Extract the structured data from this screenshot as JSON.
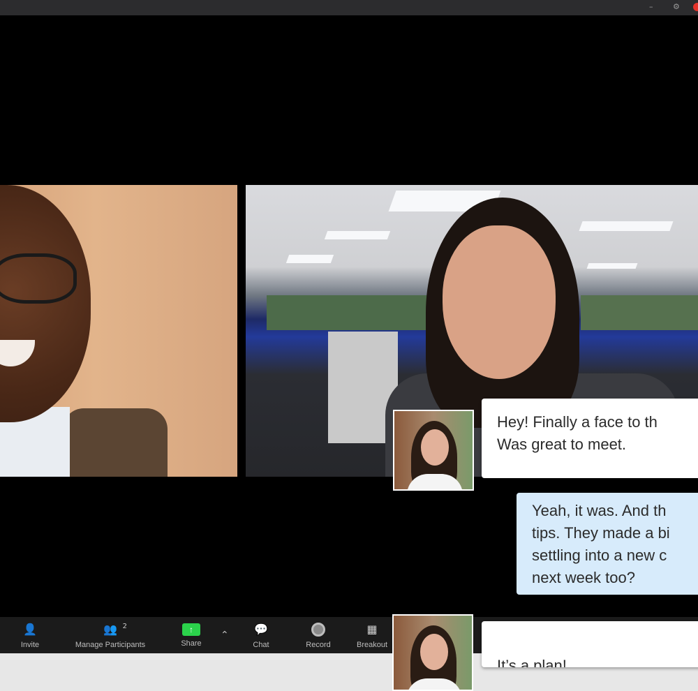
{
  "window": {
    "minimize_glyph": "–",
    "maximize_glyph": "⚙"
  },
  "chat": {
    "messages": [
      {
        "direction": "incoming",
        "text": "Hey! Finally a face to th\nWas great to meet."
      },
      {
        "direction": "outgoing",
        "text": "Yeah, it was. And th\ntips. They made a bi\nsettling into a new c\nnext week too?"
      },
      {
        "direction": "incoming",
        "text": "It’s a plan!",
        "emoji": "🥳"
      }
    ]
  },
  "toolbar": {
    "invite": {
      "label": "Invite",
      "icon": "invite-icon"
    },
    "participants": {
      "label": "Manage Participants",
      "count": "2",
      "icon": "participants-icon"
    },
    "share": {
      "label": "Share",
      "icon": "share-icon"
    },
    "chat": {
      "label": "Chat",
      "icon": "chat-icon"
    },
    "record": {
      "label": "Record",
      "icon": "record-icon"
    },
    "breakout": {
      "label": "Breakout",
      "icon": "breakout-icon"
    }
  },
  "colors": {
    "toolbar_bg": "#1b1b1b",
    "share_green": "#2bd24b",
    "incoming_bubble": "#ffffff",
    "outgoing_bubble": "#d7ebfb"
  }
}
